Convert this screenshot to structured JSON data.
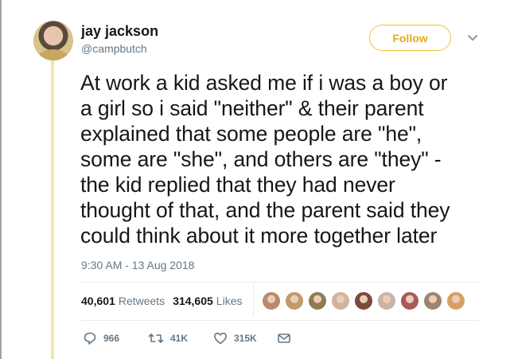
{
  "user": {
    "name": "jay jackson",
    "handle": "@campbutch"
  },
  "follow_label": "Follow",
  "tweet": {
    "text": "At work a kid asked me if i was a boy or\na girl so i said \"neither\" & their parent\nexplained that some people are \"he\",\nsome are \"she\", and others are \"they\" -\nthe kid replied that they had never\nthought of that, and the parent said they\ncould think about it more together later",
    "timestamp": "9:30 AM - 13 Aug 2018"
  },
  "stats": {
    "retweets_count": "40,601",
    "retweets_label": "Retweets",
    "likes_count": "314,605",
    "likes_label": "Likes"
  },
  "liker_avatar_colors": [
    "#b98a6c",
    "#c29a6a",
    "#8f7a52",
    "#d1b39a",
    "#7a4a3a",
    "#c9b3a8",
    "#a85a5a",
    "#9c8470",
    "#d7a060"
  ],
  "actions": {
    "replies": "966",
    "retweets": "41K",
    "likes": "315K"
  },
  "colors": {
    "accent": "#f1c232",
    "thread_line": "#f5e6a8",
    "secondary_text": "#657786"
  }
}
